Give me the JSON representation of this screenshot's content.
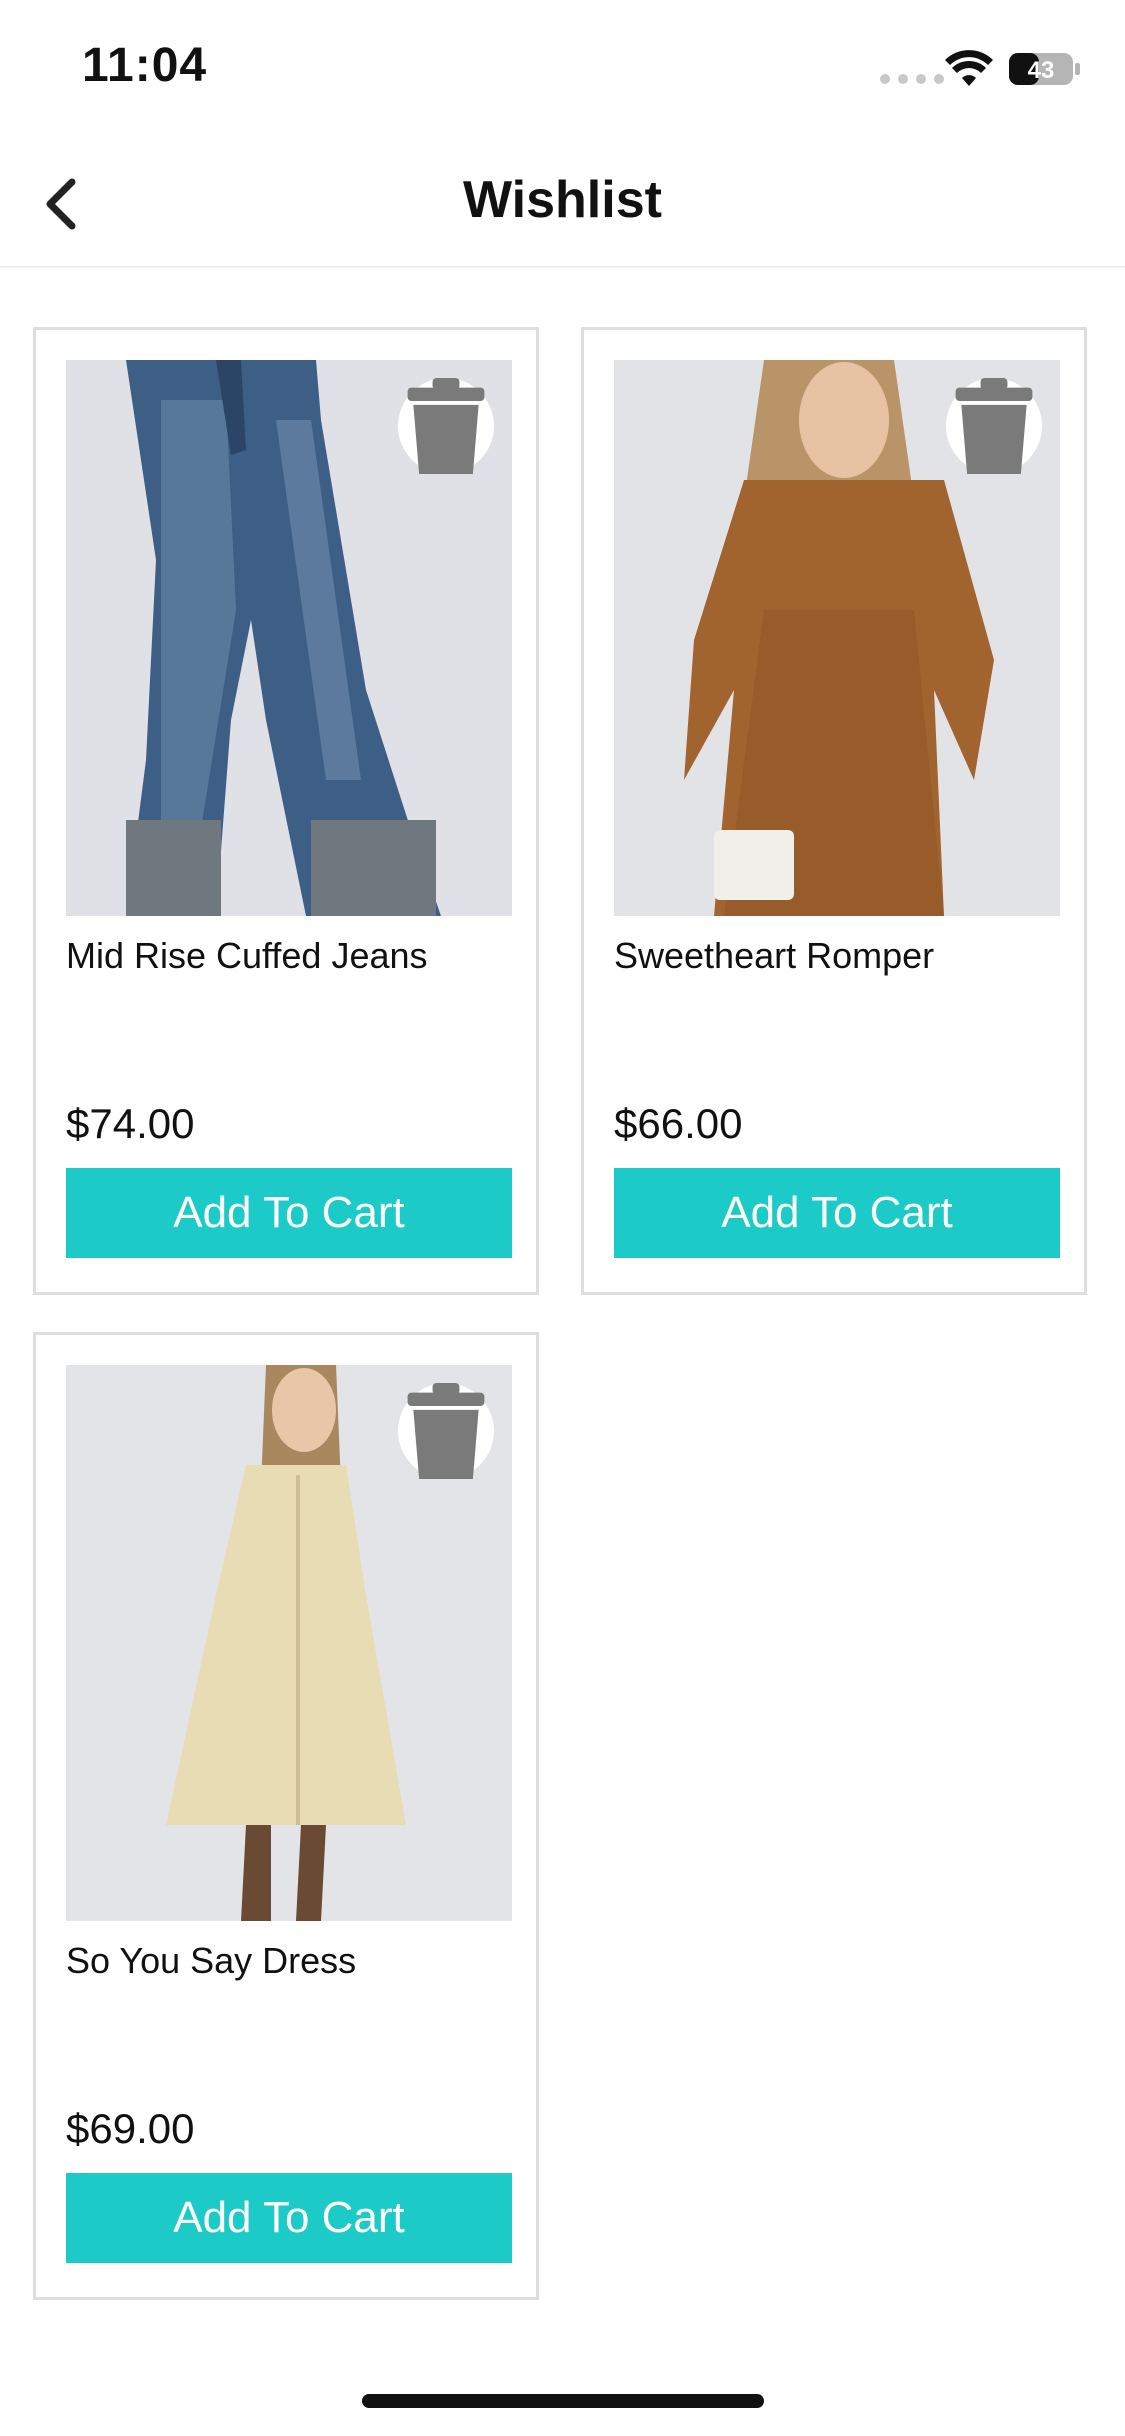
{
  "status": {
    "time": "11:04",
    "battery": "43"
  },
  "nav": {
    "title": "Wishlist"
  },
  "items": [
    {
      "name": "Mid Rise Cuffed Jeans",
      "price": "$74.00",
      "button": "Add To Cart"
    },
    {
      "name": "Sweetheart Romper",
      "price": "$66.00",
      "button": "Add To Cart"
    },
    {
      "name": "So You Say Dress",
      "price": "$69.00",
      "button": "Add To Cart"
    }
  ],
  "colors": {
    "accent": "#1ccac8",
    "trash_icon": "#7a7a7a"
  },
  "icons": {
    "back": "chevron-left-icon",
    "delete": "trash-icon",
    "wifi": "wifi-icon",
    "battery": "battery-icon"
  }
}
